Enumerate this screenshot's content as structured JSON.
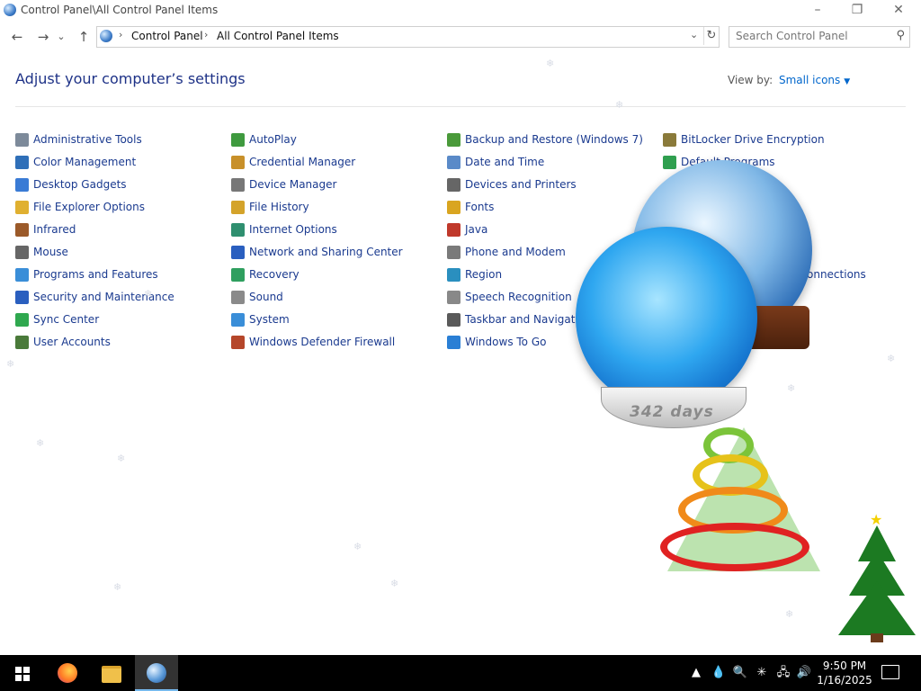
{
  "window": {
    "title": "Control Panel\\All Control Panel Items",
    "minimize_glyph": "–",
    "restore_glyph": "❐",
    "close_glyph": "✕"
  },
  "nav": {
    "back_glyph": "←",
    "forward_glyph": "→",
    "recent_glyph": "⌄",
    "up_glyph": "↑",
    "address": {
      "crumbs": [
        "Control Panel",
        "All Control Panel Items"
      ],
      "sep_glyph": "›",
      "drop_glyph": "⌄",
      "refresh_glyph": "↻"
    },
    "search": {
      "placeholder": "Search Control Panel",
      "icon_glyph": "⚲"
    }
  },
  "main": {
    "heading": "Adjust your computer’s settings",
    "view_by_label": "View by:",
    "view_by_value": "Small icons",
    "view_by_glyph": "▼"
  },
  "columns": [
    {
      "items": [
        {
          "label": "Administrative Tools",
          "icon": "admin-tools-icon",
          "color": "#7d8a9a"
        },
        {
          "label": "Color Management",
          "icon": "color-management-icon",
          "color": "#2f6fb8"
        },
        {
          "label": "Desktop Gadgets",
          "icon": "desktop-gadgets-icon",
          "color": "#3a7bd5"
        },
        {
          "label": "File Explorer Options",
          "icon": "folder-options-icon",
          "color": "#e0b030"
        },
        {
          "label": "Infrared",
          "icon": "infrared-icon",
          "color": "#9b5a2a"
        },
        {
          "label": "Mouse",
          "icon": "mouse-icon",
          "color": "#666666"
        },
        {
          "label": "Programs and Features",
          "icon": "programs-icon",
          "color": "#3a8ed8"
        },
        {
          "label": "Security and Maintenance",
          "icon": "flag-icon",
          "color": "#2a5fbf"
        },
        {
          "label": "Sync Center",
          "icon": "sync-icon",
          "color": "#2fa84f"
        },
        {
          "label": "User Accounts",
          "icon": "user-accounts-icon",
          "color": "#4a7a3a"
        }
      ]
    },
    {
      "items": [
        {
          "label": "AutoPlay",
          "icon": "autoplay-icon",
          "color": "#3f9a3f"
        },
        {
          "label": "Credential Manager",
          "icon": "credential-icon",
          "color": "#c8902a"
        },
        {
          "label": "Device Manager",
          "icon": "device-manager-icon",
          "color": "#777777"
        },
        {
          "label": "File History",
          "icon": "file-history-icon",
          "color": "#d4a32a"
        },
        {
          "label": "Internet Options",
          "icon": "internet-icon",
          "color": "#2f8f6f"
        },
        {
          "label": "Network and Sharing Center",
          "icon": "network-icon",
          "color": "#2a5fbf"
        },
        {
          "label": "Recovery",
          "icon": "recovery-icon",
          "color": "#2f9f5f"
        },
        {
          "label": "Sound",
          "icon": "speaker-icon",
          "color": "#8a8a8a"
        },
        {
          "label": "System",
          "icon": "system-icon",
          "color": "#3a8ed8"
        },
        {
          "label": "Windows Defender Firewall",
          "icon": "firewall-icon",
          "color": "#b5462a"
        }
      ]
    },
    {
      "items": [
        {
          "label": "Backup and Restore (Windows 7)",
          "icon": "backup-icon",
          "color": "#4a9a3a"
        },
        {
          "label": "Date and Time",
          "icon": "clock-icon",
          "color": "#5a8ac8"
        },
        {
          "label": "Devices and Printers",
          "icon": "printer-icon",
          "color": "#666666"
        },
        {
          "label": "Fonts",
          "icon": "fonts-icon",
          "color": "#d9a520"
        },
        {
          "label": "Java",
          "icon": "java-icon",
          "color": "#c0392b"
        },
        {
          "label": "Phone and Modem",
          "icon": "phone-icon",
          "color": "#7a7a7a"
        },
        {
          "label": "Region",
          "icon": "region-icon",
          "color": "#2a8fbf"
        },
        {
          "label": "Speech Recognition",
          "icon": "microphone-icon",
          "color": "#888888"
        },
        {
          "label": "Taskbar and Navigation",
          "icon": "taskbar-icon",
          "color": "#5a5a5a"
        },
        {
          "label": "Windows To Go",
          "icon": "windows-to-go-icon",
          "color": "#2a7fd5"
        }
      ]
    },
    {
      "items": [
        {
          "label": "BitLocker Drive Encryption",
          "icon": "bitlocker-icon",
          "color": "#8a7a3a"
        },
        {
          "label": "Default Programs",
          "icon": "default-programs-icon",
          "color": "#2f9f4f"
        }
      ],
      "partial_label": "onnections"
    }
  ],
  "overlay": {
    "countdown": "342 days"
  },
  "taskbar": {
    "time": "9:50 PM",
    "date": "1/16/2025",
    "tray_glyphs": [
      "▲",
      "💧",
      "🔍",
      "✳",
      "🖧",
      "🔊"
    ]
  }
}
